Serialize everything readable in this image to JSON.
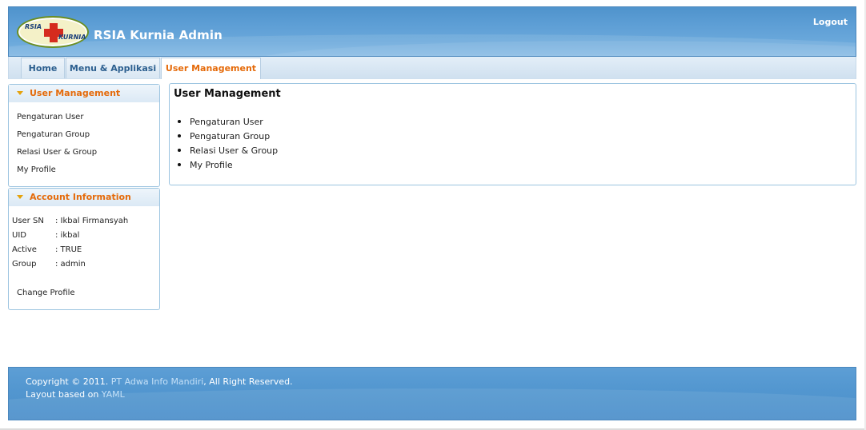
{
  "header": {
    "logo_text_left": "RSIA",
    "logo_text_right": "KURNIA",
    "title": "RSIA Kurnia Admin",
    "logout_label": "Logout"
  },
  "nav": {
    "tabs": [
      {
        "label": "Home",
        "active": false
      },
      {
        "label": "Menu & Applikasi",
        "active": false
      },
      {
        "label": "User Management",
        "active": true
      }
    ]
  },
  "sidebar": {
    "user_management": {
      "title": "User Management",
      "items": [
        {
          "label": "Pengaturan User"
        },
        {
          "label": "Pengaturan Group"
        },
        {
          "label": "Relasi User & Group"
        },
        {
          "label": "My Profile"
        }
      ]
    },
    "account_info": {
      "title": "Account Information",
      "rows": [
        {
          "key": "User SN",
          "value": ": Ikbal Firmansyah"
        },
        {
          "key": "UID",
          "value": ": ikbal"
        },
        {
          "key": "Active",
          "value": ": TRUE"
        },
        {
          "key": "Group",
          "value": ": admin"
        }
      ],
      "change_profile_label": "Change Profile"
    }
  },
  "main": {
    "title": "User Management",
    "items": [
      {
        "label": "Pengaturan User"
      },
      {
        "label": "Pengaturan Group"
      },
      {
        "label": "Relasi User & Group"
      },
      {
        "label": "My Profile"
      }
    ]
  },
  "footer": {
    "copyright_prefix": "Copyright © 2011.",
    "company_link": "PT Adwa Info Mandiri",
    "copyright_suffix": ", All Right Reserved.",
    "layout_prefix": "Layout based on",
    "yaml_link": "YAML"
  },
  "colors": {
    "header_blue": "#5d9ed5",
    "accent_orange": "#e56b0b",
    "border_blue": "#9cc4e0"
  }
}
